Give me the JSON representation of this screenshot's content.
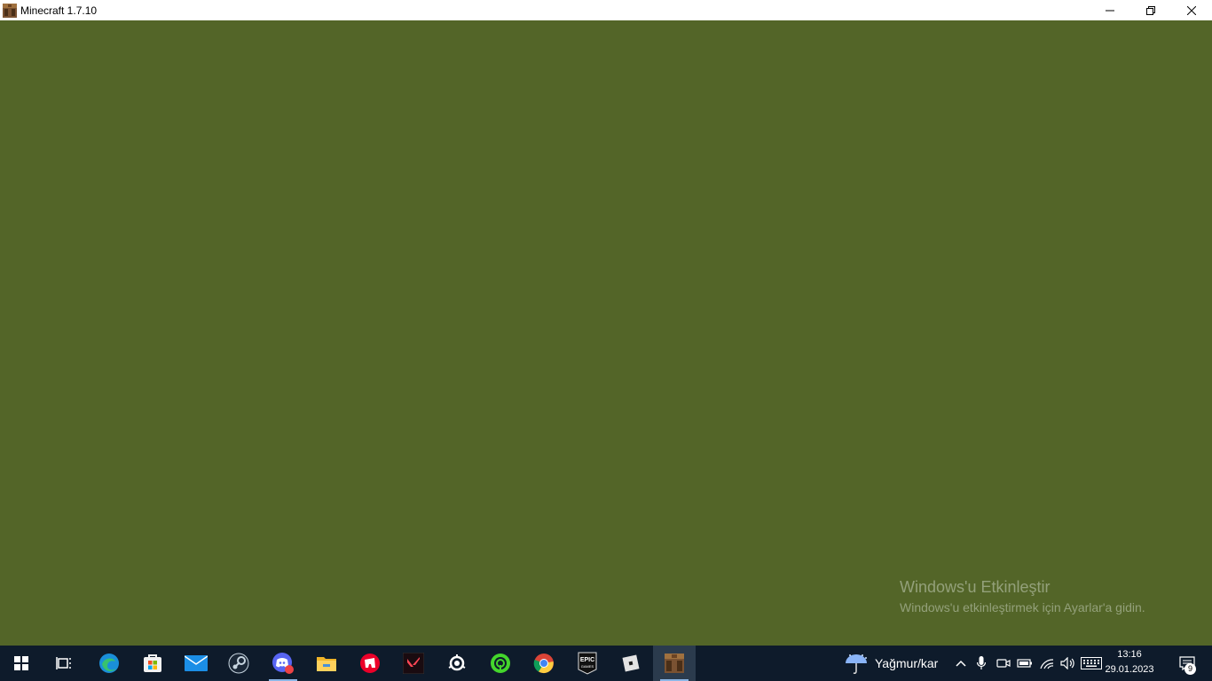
{
  "window": {
    "title": "Minecraft 1.7.10",
    "icon": "minecraft-crafting-table-icon",
    "buttons": [
      "minimize-icon",
      "restore-icon",
      "close-icon"
    ]
  },
  "game": {
    "background_color": "#536528"
  },
  "watermark": {
    "title": "Windows'u Etkinleştir",
    "subtitle": "Windows'u etkinleştirmek için Ayarlar'a gidin."
  },
  "taskbar": {
    "apps": [
      {
        "name": "start-icon"
      },
      {
        "name": "task-view-icon"
      },
      {
        "name": "edge-icon"
      },
      {
        "name": "microsoft-store-icon"
      },
      {
        "name": "mail-icon"
      },
      {
        "name": "steam-icon"
      },
      {
        "name": "discord-icon"
      },
      {
        "name": "file-explorer-icon"
      },
      {
        "name": "riot-client-icon"
      },
      {
        "name": "valorant-icon"
      },
      {
        "name": "steelseries-icon"
      },
      {
        "name": "razer-cortex-icon"
      },
      {
        "name": "chrome-icon"
      },
      {
        "name": "epic-games-icon"
      },
      {
        "name": "roblox-icon"
      },
      {
        "name": "minecraft-icon"
      }
    ],
    "weather_label": "Yağmur/kar",
    "time": "13:16",
    "date": "29.01.2023",
    "notification_count": "9"
  }
}
